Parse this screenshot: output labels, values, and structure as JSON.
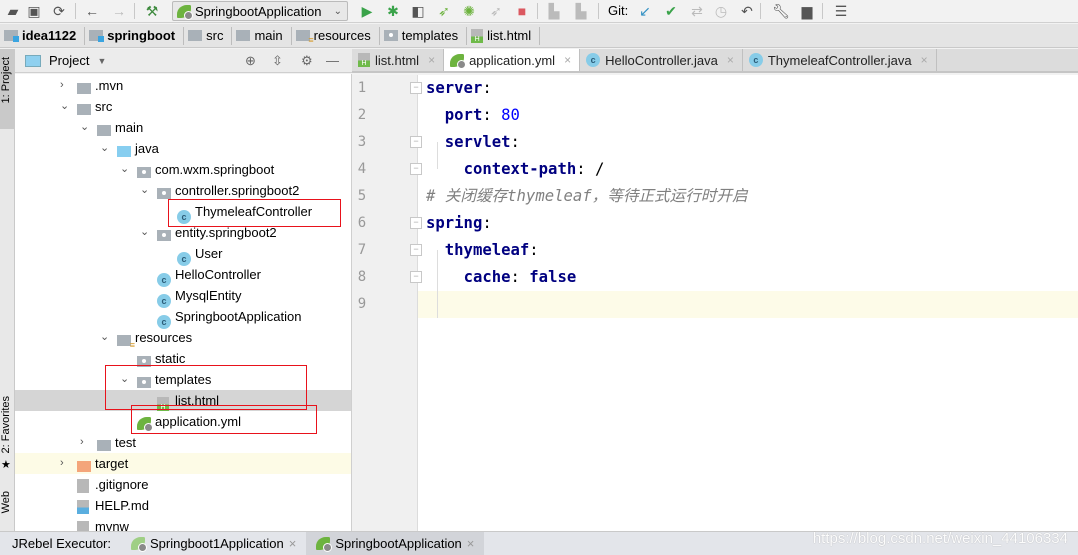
{
  "toolbar": {
    "run_config": "SpringbootApplication",
    "git_label": "Git:"
  },
  "breadcrumb": [
    "idea1122",
    "springboot",
    "src",
    "main",
    "resources",
    "templates",
    "list.html"
  ],
  "left_stripe": {
    "project": "1: Project",
    "favorites": "2: Favorites",
    "web": "Web"
  },
  "project_panel": {
    "title": "Project"
  },
  "tree": [
    {
      "label": ".mvn",
      "level": 0,
      "arrow": "collapsed",
      "icon": "folder"
    },
    {
      "label": "src",
      "level": 0,
      "arrow": "expanded",
      "icon": "folder"
    },
    {
      "label": "main",
      "level": 1,
      "arrow": "expanded",
      "icon": "folder"
    },
    {
      "label": "java",
      "level": 2,
      "arrow": "expanded",
      "icon": "source-folder"
    },
    {
      "label": "com.wxm.springboot",
      "level": 3,
      "arrow": "expanded",
      "icon": "package"
    },
    {
      "label": "controller.springboot2",
      "level": 4,
      "arrow": "expanded",
      "icon": "package"
    },
    {
      "label": "ThymeleafController",
      "level": 5,
      "icon": "class"
    },
    {
      "label": "entity.springboot2",
      "level": 4,
      "arrow": "expanded",
      "icon": "package"
    },
    {
      "label": "User",
      "level": 5,
      "icon": "class"
    },
    {
      "label": "HelloController",
      "level": 4,
      "icon": "class"
    },
    {
      "label": "MysqlEntity",
      "level": 4,
      "icon": "class"
    },
    {
      "label": "SpringbootApplication",
      "level": 4,
      "icon": "spring-boot-class"
    },
    {
      "label": "resources",
      "level": 2,
      "arrow": "expanded",
      "icon": "resources-folder"
    },
    {
      "label": "static",
      "level": 3,
      "icon": "package"
    },
    {
      "label": "templates",
      "level": 3,
      "arrow": "expanded",
      "icon": "package"
    },
    {
      "label": "list.html",
      "level": 4,
      "icon": "html",
      "selected": true
    },
    {
      "label": "application.yml",
      "level": 3,
      "icon": "spring-yml"
    },
    {
      "label": "test",
      "level": 1,
      "arrow": "collapsed",
      "icon": "folder"
    },
    {
      "label": "target",
      "level": 0,
      "arrow": "collapsed",
      "icon": "excluded-folder",
      "highlighted": true
    },
    {
      "label": ".gitignore",
      "level": 0,
      "icon": "text-file"
    },
    {
      "label": "HELP.md",
      "level": 0,
      "icon": "markdown"
    },
    {
      "label": "mvnw",
      "level": 0,
      "icon": "text-file"
    }
  ],
  "editor_tabs": [
    {
      "label": "list.html",
      "icon": "html",
      "active": false
    },
    {
      "label": "application.yml",
      "icon": "spring-yml",
      "active": true
    },
    {
      "label": "HelloController.java",
      "icon": "class",
      "active": false
    },
    {
      "label": "ThymeleafController.java",
      "icon": "class",
      "active": false
    }
  ],
  "code_lines": [
    "server:",
    "  port: 80",
    "  servlet:",
    "    context-path: /",
    "# 关闭缓存thymeleaf，等待正式运行时开启",
    "spring:",
    "  thymeleaf:",
    "    cache: false",
    ""
  ],
  "bottom_bar": {
    "label": "JRebel Executor:",
    "tabs": [
      "Springboot1Application",
      "SpringbootApplication"
    ]
  },
  "watermark": "https://blog.csdn.net/weixin_44106334",
  "colors": {
    "annotation_box": "#e8121b",
    "yaml_key": "#000080",
    "number": "#0000ff",
    "comment": "#808080"
  }
}
